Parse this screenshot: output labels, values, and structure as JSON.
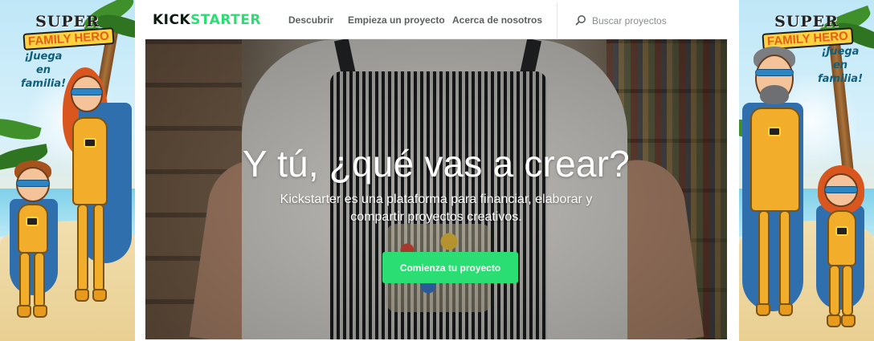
{
  "left_banner": {
    "brand_super": "SUPER",
    "brand_family_hero": "FAMILY HERO",
    "tagline_line1": "¡Juega",
    "tagline_line2": "en",
    "tagline_line3": "familia!"
  },
  "right_banner": {
    "brand_super": "SUPER",
    "brand_family_hero": "FAMILY HERO",
    "tagline_line1": "¡Juega",
    "tagline_line2": "en",
    "tagline_line3": "familia!"
  },
  "nav": {
    "logo_part1": "KICK",
    "logo_part2": "STARTER",
    "links": [
      "Descubrir",
      "Empieza un proyecto",
      "Acerca de nosotros"
    ],
    "search_placeholder": "Buscar proyectos",
    "search_icon": "search-icon"
  },
  "hero": {
    "title": "Y tú, ¿qué vas a crear?",
    "subtitle": "Kickstarter es una plataforma para financiar, elaborar y compartir proyectos creativos.",
    "cta_label": "Comienza tu proyecto"
  },
  "colors": {
    "kickstarter_green": "#2bde73",
    "logo_dark": "#0b1a0e",
    "nav_link": "#5c5f60",
    "banner_sky": "#bfe7f7",
    "banner_sand": "#f1dfae",
    "hero_suit_yellow": "#f2ae2a",
    "hero_mask_blue": "#2d86c4"
  }
}
